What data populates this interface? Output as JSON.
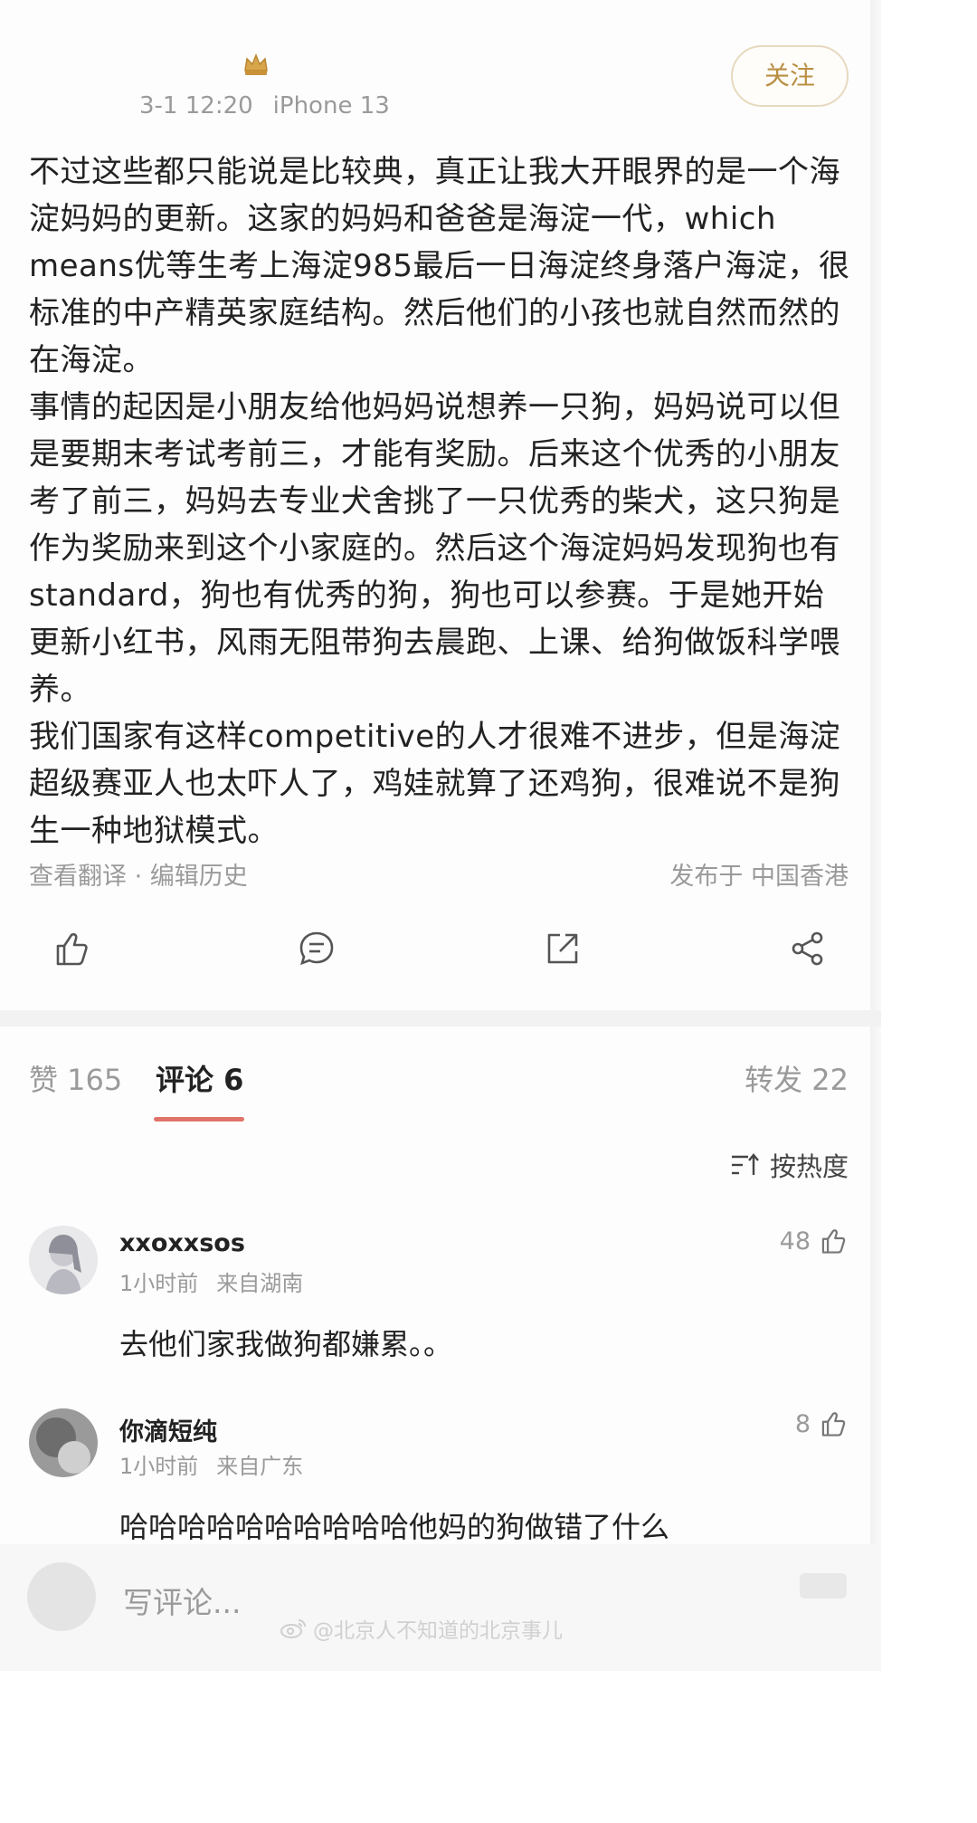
{
  "post": {
    "date": "3-1 12:20",
    "device": "iPhone 13",
    "follow_label": "关注",
    "paragraphs": [
      "不过这些都只能说是比较典，真正让我大开眼界的是一个海淀妈妈的更新。这家的妈妈和爸爸是海淀一代，which means优等生考上海淀985最后一日海淀终身落户海淀，很标准的中产精英家庭结构。然后他们的小孩也就自然而然的在海淀。",
      "事情的起因是小朋友给他妈妈说想养一只狗，妈妈说可以但是要期末考试考前三，才能有奖励。后来这个优秀的小朋友考了前三，妈妈去专业犬舍挑了一只优秀的柴犬，这只狗是作为奖励来到这个小家庭的。然后这个海淀妈妈发现狗也有standard，狗也有优秀的狗，狗也可以参赛。于是她开始更新小红书，风雨无阻带狗去晨跑、上课、给狗做饭科学喂养。",
      "我们国家有这样competitive的人才很难不进步，但是海淀超级赛亚人也太吓人了，鸡娃就算了还鸡狗，很难说不是狗生一种地狱模式。"
    ],
    "footer_left": "查看翻译 · 编辑历史",
    "footer_right": "发布于 中国香港"
  },
  "tabs": {
    "likes": "赞 165",
    "comments": "评论 6",
    "reposts": "转发 22"
  },
  "sort_label": "按热度",
  "comments": [
    {
      "username": "xxoxxsos",
      "time": "1小时前",
      "location": "来自湖南",
      "text": "去他们家我做狗都嫌累。。",
      "likes": "48"
    },
    {
      "username": "你滴短纯",
      "time": "1小时前",
      "location": "来自广东",
      "text": "哈哈哈哈哈哈哈哈哈哈他妈的狗做错了什么",
      "likes": "8"
    }
  ],
  "bottom_bar": {
    "placeholder": "写评论..."
  },
  "watermark": "@北京人不知道的北京事儿",
  "colors": {
    "accent": "#e0736a",
    "follow_gold": "#b98f43",
    "muted": "#9a9a9a"
  },
  "icons": [
    "crown-icon",
    "like-icon",
    "comment-icon",
    "share-icon",
    "share-nodes-icon",
    "sort-icon",
    "weibo-icon"
  ]
}
